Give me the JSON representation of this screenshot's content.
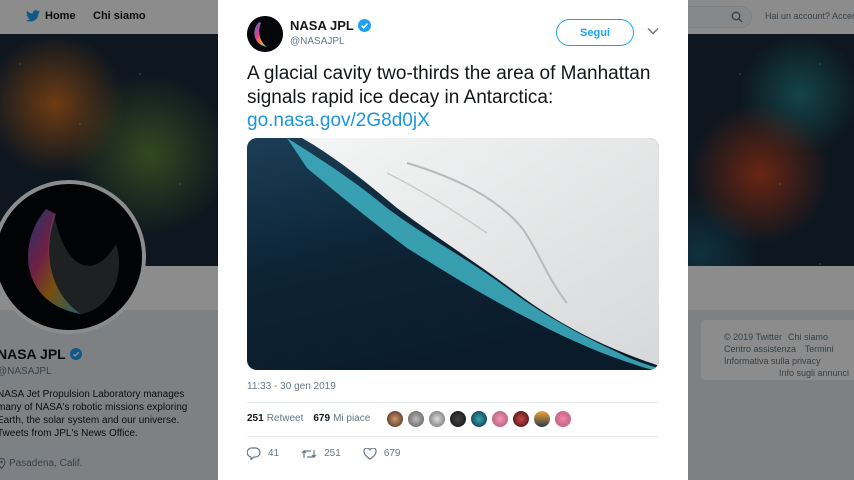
{
  "nav": {
    "home_label": "Home",
    "about_label": "Chi siamo",
    "account_prompt": "Hai un account? Accedi"
  },
  "profile": {
    "name": "NASA JPL",
    "handle": "@NASAJPL",
    "bio": "NASA Jet Propulsion Laboratory manages many of NASA's robotic missions exploring Earth, the solar system and our universe. Tweets from JPL's News Office.",
    "location": "Pasadena, Calif."
  },
  "footer": {
    "links": [
      "© 2019 Twitter",
      "Chi siamo",
      "Centro assistenza",
      "Termini",
      "Informativa sulla privacy",
      "Info sugli annunci"
    ]
  },
  "tweet": {
    "author_name": "NASA JPL",
    "author_handle": "@NASAJPL",
    "follow_label": "Segui",
    "text": "A glacial cavity two-thirds the area of Manhattan signals rapid ice decay in Antarctica: ",
    "link_text": "go.nasa.gov/2G8d0jX",
    "timestamp": "11:33 - 30 gen 2019",
    "retweets_count": "251",
    "retweets_label": "Retweet",
    "likes_count": "679",
    "likes_label": "Mi piace",
    "actions": {
      "replies": "41",
      "retweets": "251",
      "likes": "679"
    }
  },
  "colors": {
    "brand": "#1da1f2",
    "link": "#1b95e0",
    "text": "#14171a",
    "muted": "#657786"
  },
  "icons": [
    "twitter-bird-icon",
    "search-icon",
    "verified-badge-icon",
    "chevron-down-icon",
    "location-pin-icon",
    "reply-icon",
    "retweet-icon",
    "like-icon"
  ]
}
